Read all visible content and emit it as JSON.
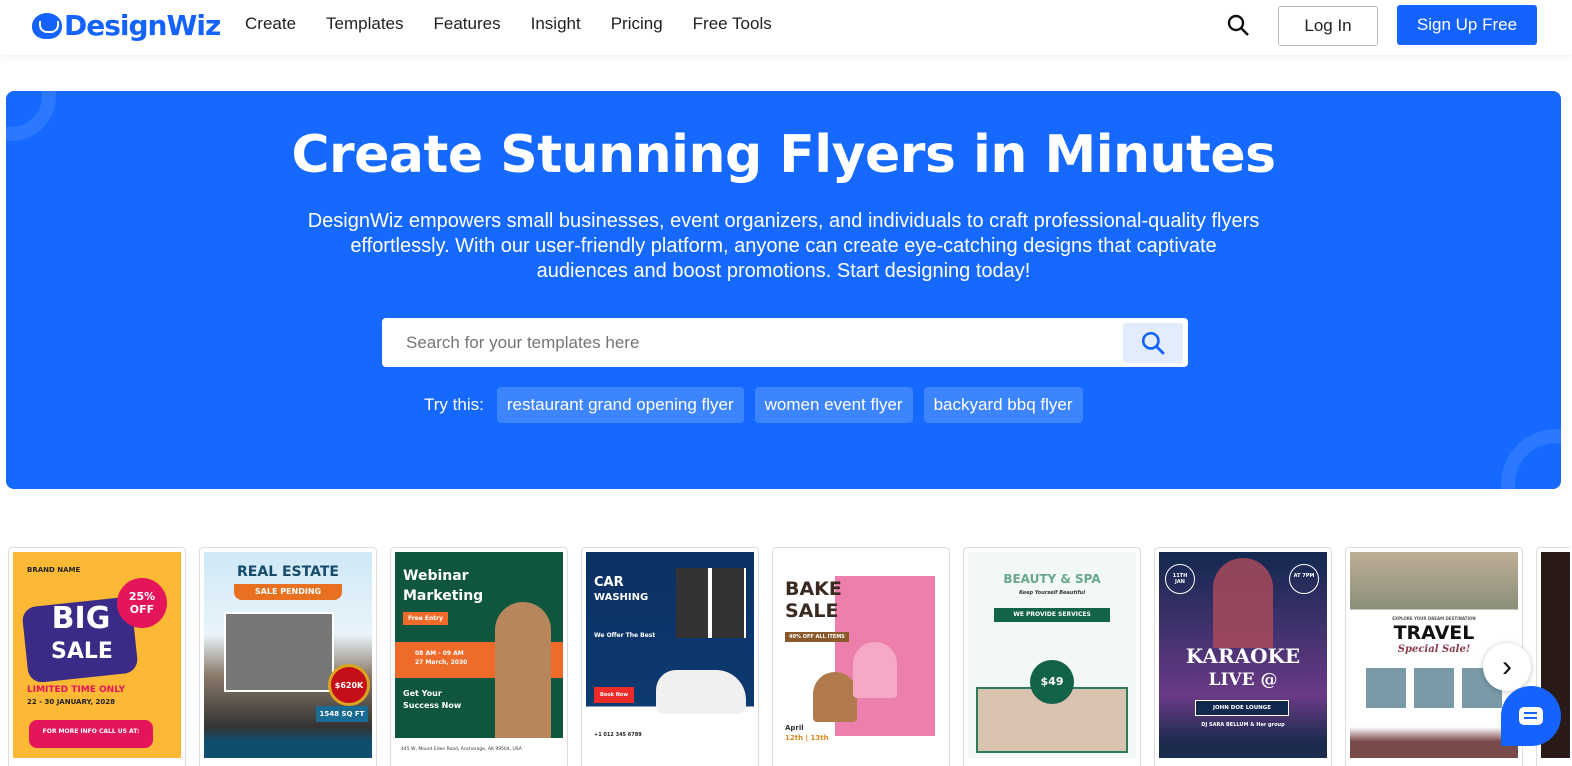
{
  "nav": {
    "brand": "DesignWiz",
    "items": [
      "Create",
      "Templates",
      "Features",
      "Insight",
      "Pricing",
      "Free Tools"
    ],
    "login": "Log In",
    "signup": "Sign Up Free"
  },
  "hero": {
    "title": "Create Stunning Flyers in Minutes",
    "subtitle": "DesignWiz empowers small businesses, event organizers, and individuals to craft professional-quality flyers effortlessly. With our user-friendly platform, anyone can create eye-catching designs that captivate audiences and boost promotions. Start designing today!",
    "search_placeholder": "Search for your templates here",
    "try_label": "Try this:",
    "suggestions": [
      "restaurant grand opening flyer",
      "women event flyer",
      "backyard bbq flyer"
    ]
  },
  "templates": [
    {
      "t1": "BIG",
      "t2": "SALE",
      "t3": "25% OFF",
      "t4": "LIMITED TIME ONLY",
      "t5": "22 - 30 JANUARY, 2028",
      "t6": "FOR MORE INFO CALL US AT:",
      "t7": "BRAND NAME"
    },
    {
      "t1": "REAL ESTATE",
      "t2": "SALE PENDING",
      "t3": "$620K",
      "t4": "1548 SQ FT"
    },
    {
      "t1": "Webinar",
      "t2": "Marketing",
      "t3": "Free Entry",
      "t4": "08 AM - 09 AM",
      "t5": "27 March, 2030",
      "t6": "Get Your Success Now",
      "t7": "445 W, Mount Eden Road, Anchorage, AK 99504, USA"
    },
    {
      "t1": "CAR",
      "t2": "WASHING",
      "t3": "We Offer The Best",
      "t4": "Book Now",
      "t5": "+1 012 345 6789"
    },
    {
      "t1": "BAKE",
      "t2": "SALE",
      "t3": "40% OFF ALL ITEMS",
      "t4": "April",
      "t5": "12th | 13th"
    },
    {
      "t1": "BEAUTY & SPA",
      "t2": "Keep Yourself Beautiful",
      "t3": "WE PROVIDE SERVICES",
      "t4": "$49"
    },
    {
      "t1": "KARAOKE",
      "t2": "LIVE @",
      "t3": "JOHN DOE LOUNGE",
      "t4": "DJ SARA BELLUM & Her group",
      "t5": "11TH JAN",
      "t6": "AT 7PM"
    },
    {
      "t1": "TRAVEL",
      "t2": "Special Sale!",
      "t3": "EXPLORE YOUR DREAM DESTINATION"
    }
  ],
  "colors": {
    "brand": "#1463ff",
    "hero": "#1569ff"
  }
}
